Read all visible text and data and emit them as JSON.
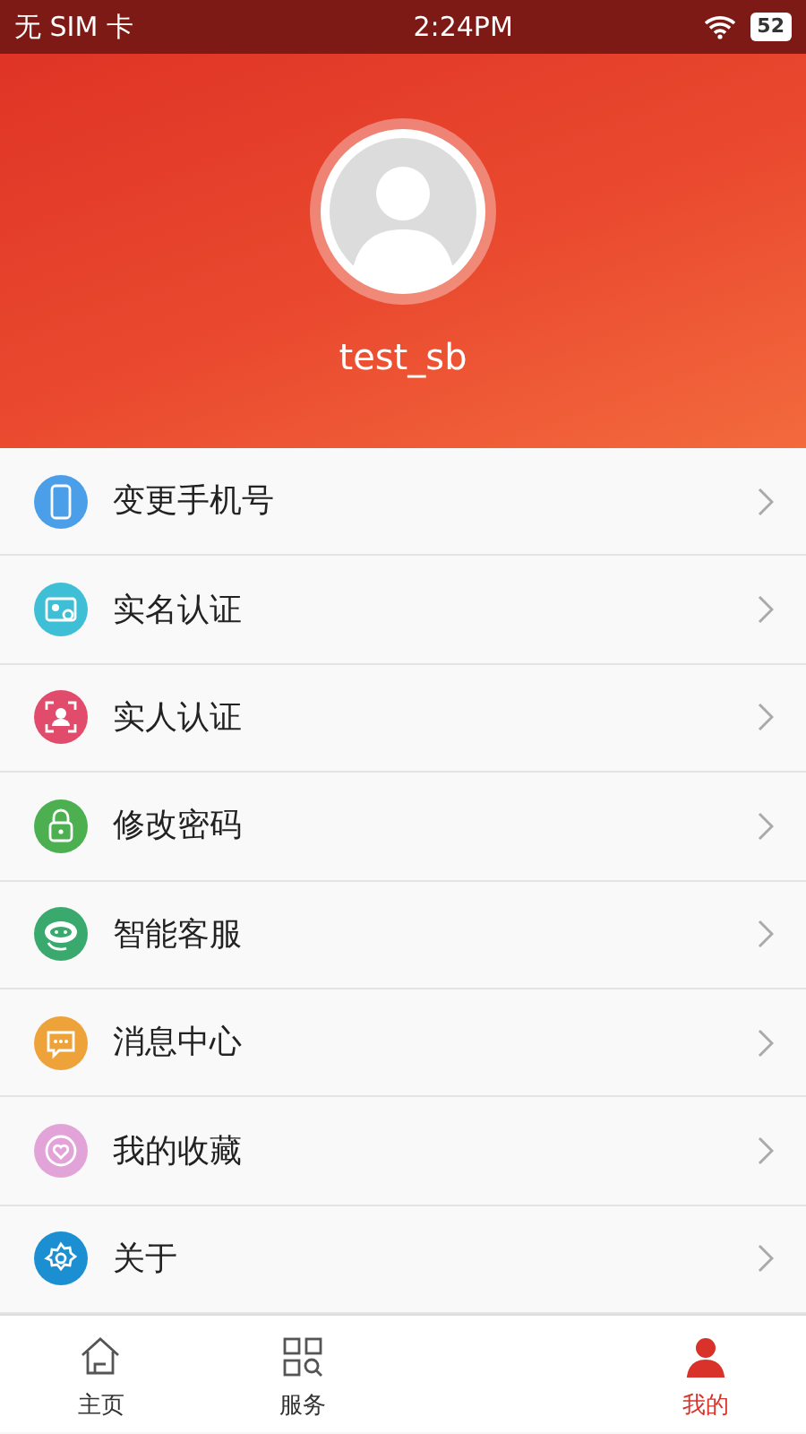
{
  "status_bar": {
    "carrier": "无 SIM 卡",
    "time": "2:24PM",
    "battery": "52"
  },
  "profile": {
    "username": "test_sb"
  },
  "menu": [
    {
      "label": "变更手机号",
      "color": "#4a9fe8"
    },
    {
      "label": "实名认证",
      "color": "#3fbfd6"
    },
    {
      "label": "实人认证",
      "color": "#e24c6c"
    },
    {
      "label": "修改密码",
      "color": "#4cb051"
    },
    {
      "label": "智能客服",
      "color": "#3aa96d"
    },
    {
      "label": "消息中心",
      "color": "#eea23a"
    },
    {
      "label": "我的收藏",
      "color": "#e2a3d8"
    },
    {
      "label": "关于",
      "color": "#1b8fd2"
    }
  ],
  "tab_bar": [
    {
      "label": "主页",
      "selected": false
    },
    {
      "label": "服务",
      "selected": false
    },
    {
      "label": "我的",
      "selected": true
    }
  ]
}
